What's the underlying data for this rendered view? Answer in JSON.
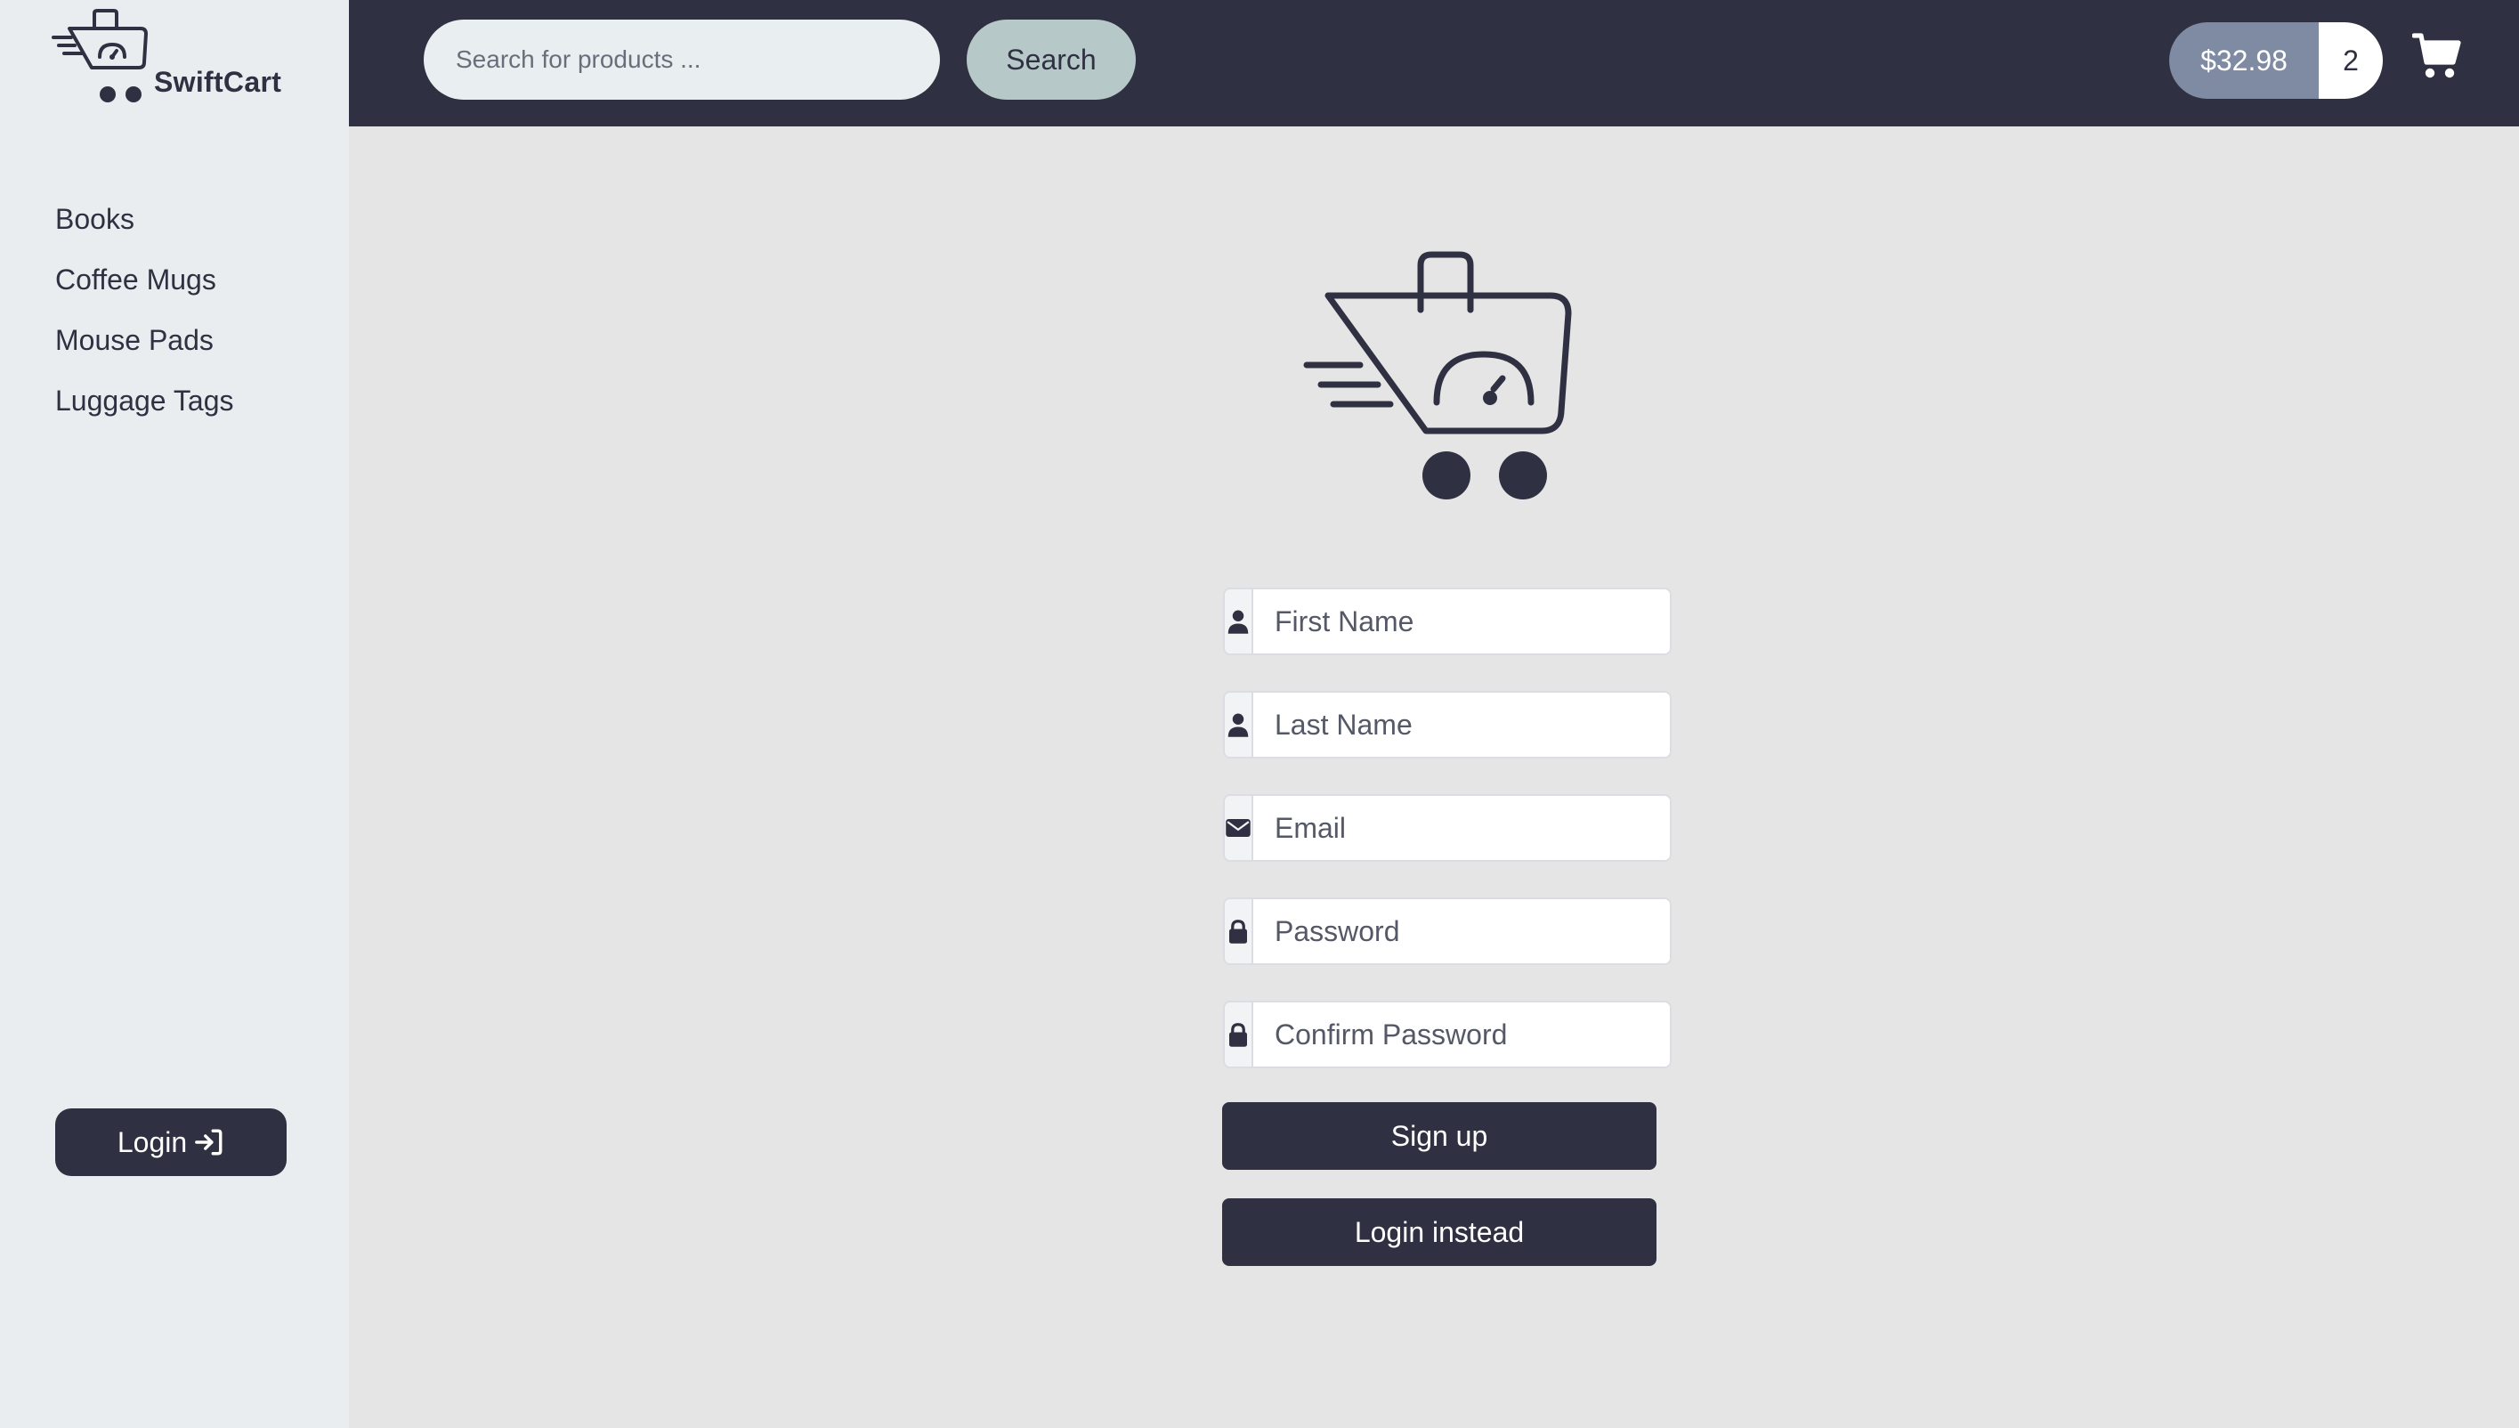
{
  "brand": {
    "name": "SwiftCart"
  },
  "sidebar": {
    "items": [
      {
        "label": "Books"
      },
      {
        "label": "Coffee Mugs"
      },
      {
        "label": "Mouse Pads"
      },
      {
        "label": "Luggage Tags"
      }
    ],
    "login_label": "Login",
    "login_icon": "arrow-right-to-bracket-icon"
  },
  "header": {
    "search_placeholder": "Search for products ...",
    "search_label": "Search",
    "cart_total": "$32.98",
    "cart_count": "2",
    "cart_icon": "shopping-cart-icon"
  },
  "form": {
    "first_name_placeholder": "First Name",
    "last_name_placeholder": "Last Name",
    "email_placeholder": "Email",
    "password_placeholder": "Password",
    "confirm_password_placeholder": "Confirm Password",
    "signup_label": "Sign up",
    "login_instead_label": "Login instead"
  },
  "colors": {
    "navy": "#2f3142",
    "sidebar_bg": "#eaedef",
    "main_bg": "#e5e5e5",
    "search_btn_bg": "#b7c8c8",
    "cart_total_bg": "#7f8aa3"
  }
}
